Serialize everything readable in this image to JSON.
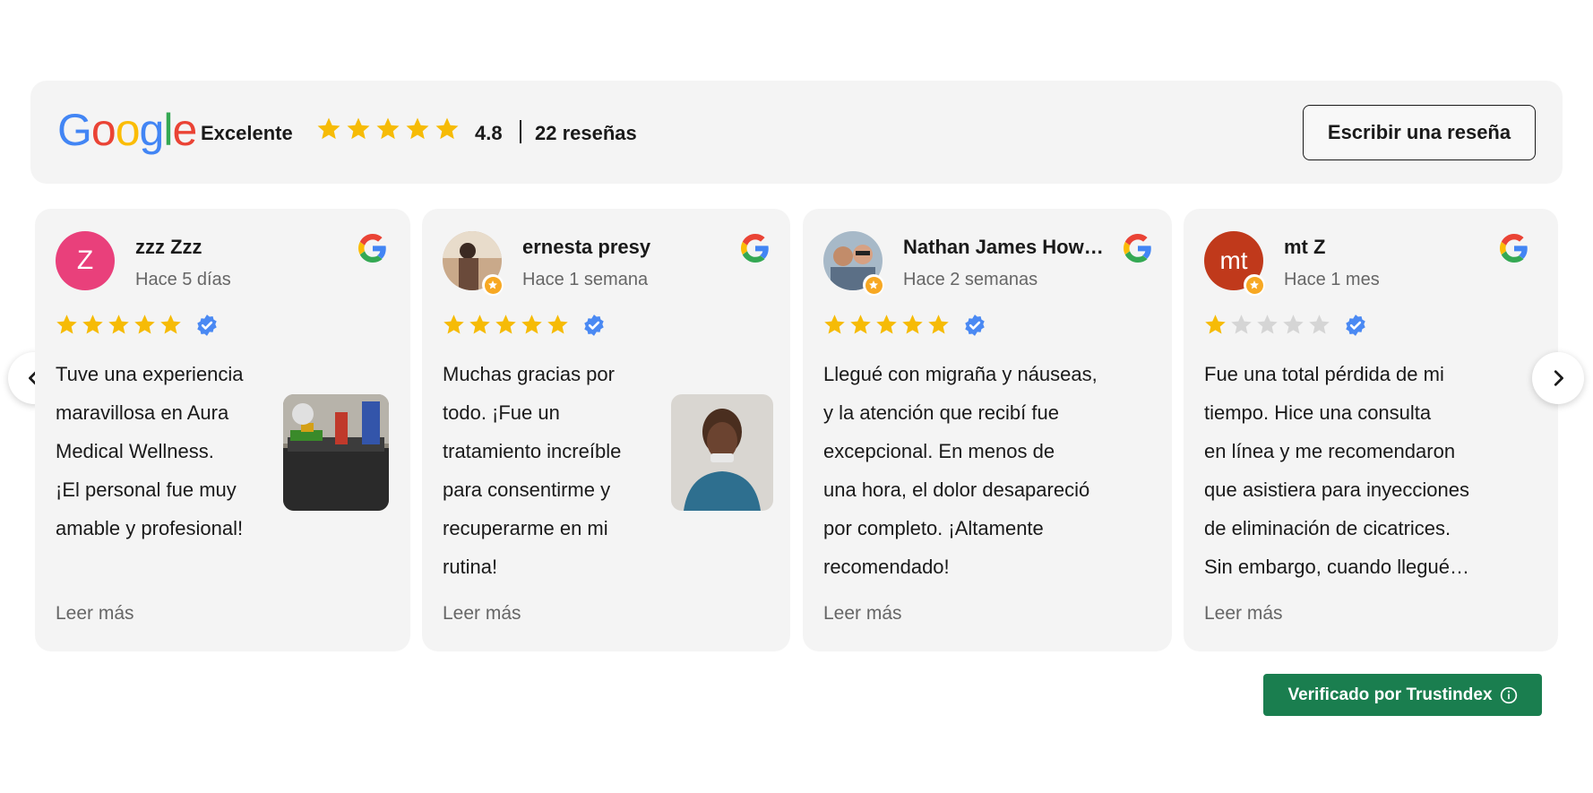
{
  "header": {
    "brand": "Google",
    "rating_label": "Excelente",
    "score": "4.8",
    "review_count": "22 reseñas",
    "write_button": "Escribir una reseña",
    "stars_filled": 5
  },
  "reviews": [
    {
      "name": "zzz Zzz",
      "date": "Hace 5 días",
      "stars": 5,
      "avatar_initials": "Z",
      "avatar_color": "#e9407b",
      "text_lines": [
        "Tuve una experiencia",
        "maravillosa en Aura",
        "Medical Wellness.",
        "¡El personal fue muy",
        "amable y profesional!"
      ],
      "read_more": "Leer más"
    },
    {
      "name": "ernesta presy",
      "date": "Hace 1 semana",
      "stars": 5,
      "text_lines": [
        "Muchas gracias por",
        "todo. ¡Fue un",
        "tratamiento increíble",
        "para consentirme y",
        "recuperarme en mi",
        "rutina!"
      ],
      "read_more": "Leer más"
    },
    {
      "name": "Nathan James How…",
      "date": "Hace 2 semanas",
      "stars": 5,
      "text_lines": [
        "Llegué con migraña y náuseas,",
        "y la atención que recibí fue",
        "excepcional. En menos de",
        "una hora, el dolor desapareció",
        "por completo. ¡Altamente",
        "recomendado!"
      ],
      "read_more": "Leer más"
    },
    {
      "name": "mt Z",
      "date": "Hace 1 mes",
      "stars": 1,
      "avatar_initials": "mt",
      "avatar_color": "#c0391b",
      "text_lines": [
        "Fue una total pérdida de mi",
        "tiempo. Hice una consulta",
        "en línea y me recomendaron",
        "que asistiera para inyecciones",
        "de eliminación de cicatrices.",
        "Sin embargo, cuando llegué…"
      ],
      "read_more": "Leer más"
    }
  ],
  "footer": {
    "trust_label": "Verificado por Trustindex"
  },
  "colors": {
    "star": "#f6bb06",
    "star_empty": "#d5d5d5",
    "verified": "#4a89f3",
    "trust_green": "#1a7e4f"
  }
}
